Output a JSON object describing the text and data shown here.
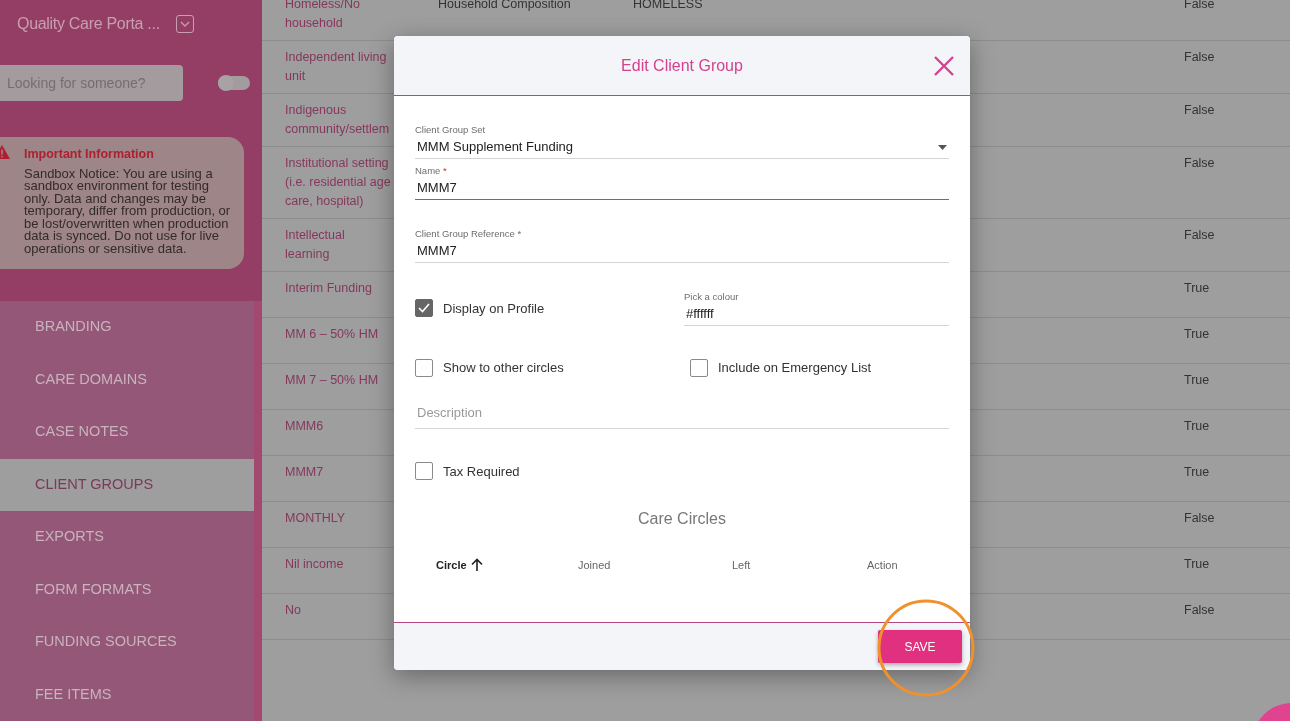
{
  "sidebar": {
    "title": "Quality Care Porta ...",
    "search": {
      "placeholder": "Looking for someone?"
    },
    "toggle": {
      "on": false
    },
    "notice": {
      "title": "Important Information",
      "text": "Sandbox Notice: You are using a sandbox environment for testing only. Data and changes may be temporary, differ from production, or be lost/overwritten when production data is synced. Do not use for live operations or sensitive data."
    },
    "nav": [
      {
        "label": "BRANDING",
        "selected": false
      },
      {
        "label": "CARE DOMAINS",
        "selected": false
      },
      {
        "label": "CASE NOTES",
        "selected": false
      },
      {
        "label": "CLIENT GROUPS",
        "selected": true
      },
      {
        "label": "EXPORTS",
        "selected": false
      },
      {
        "label": "FORM FORMATS",
        "selected": false
      },
      {
        "label": "FUNDING SOURCES",
        "selected": false
      },
      {
        "label": "FEE ITEMS",
        "selected": false
      }
    ]
  },
  "table": {
    "rows": [
      {
        "name": "Homeless/No household",
        "column_2": "Household Composition",
        "column_3": "HOMELESS",
        "column_4": "False"
      },
      {
        "name": "Independent living unit",
        "column_4": "False"
      },
      {
        "name": "Indigenous community/settlem",
        "column_4": "False"
      },
      {
        "name": "Institutional setting (i.e. residential age care, hospital)",
        "column_4": "False"
      },
      {
        "name": "Intellectual learning",
        "column_4": "False"
      },
      {
        "name": "Interim Funding",
        "column_4": "True"
      },
      {
        "name": "MM 6 – 50% HM",
        "column_4": "True"
      },
      {
        "name": "MM 7 – 50% HM",
        "column_4": "True"
      },
      {
        "name": "MMM6",
        "column_4": "True"
      },
      {
        "name": "MMM7",
        "column_4": "True"
      },
      {
        "name": "MONTHLY",
        "column_4": "False"
      },
      {
        "name": "Nil income",
        "column_4": "True"
      },
      {
        "name": "No",
        "column_4": "False"
      }
    ]
  },
  "modal": {
    "title": "Edit Client Group",
    "client_group_set": {
      "label": "Client Group Set",
      "value": "MMM Supplement Funding"
    },
    "name": {
      "label": "Name",
      "required_mark": "*",
      "value": "MMM7",
      "focused": true
    },
    "reference": {
      "label": "Client Group Reference",
      "required_mark": "*",
      "value": "MMM7",
      "focused": false
    },
    "display_on_profile": {
      "label": "Display on Profile",
      "checked": true
    },
    "colour": {
      "label": "Pick a colour",
      "value": "#ffffff"
    },
    "show_to_other_circles": {
      "label": "Show to other circles",
      "checked": false
    },
    "include_on_emergency_list": {
      "label": "Include on Emergency List",
      "checked": false
    },
    "description": {
      "placeholder": "Description"
    },
    "tax_required": {
      "label": "Tax Required",
      "checked": false
    },
    "care_circles": {
      "title": "Care Circles",
      "columns": [
        {
          "label": "Circle",
          "sorted": true
        },
        {
          "label": "Joined",
          "sorted": false
        },
        {
          "label": "Left",
          "sorted": false
        },
        {
          "label": "Action",
          "sorted": false
        }
      ]
    },
    "save_button": "SAVE"
  }
}
